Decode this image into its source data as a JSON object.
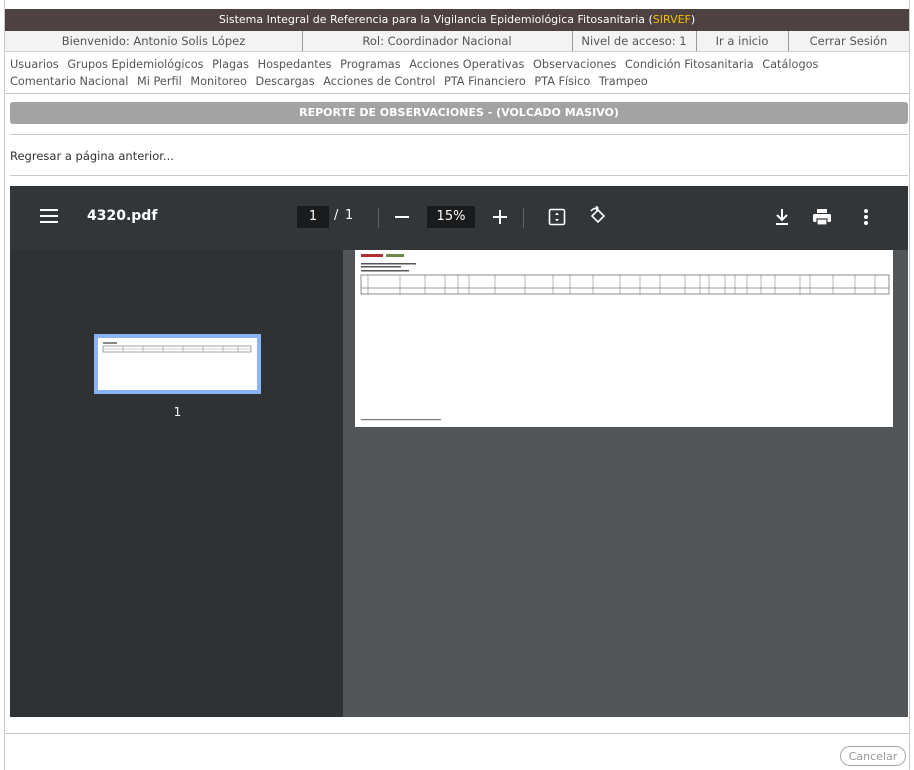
{
  "app": {
    "title_prefix": "Sistema Integral de Referencia para la Vigilancia Epidemiológica Fitosanitaria (",
    "title_highlight": "SIRVEF",
    "title_suffix": ")"
  },
  "userbar": {
    "welcome": "Bienvenido: Antonio Solis López",
    "role": "Rol: Coordinador Nacional",
    "access": "Nivel de acceso: 1",
    "home": "Ir a inicio",
    "logout": "Cerrar Sesión"
  },
  "menu": {
    "items": [
      "Usuarios",
      "Grupos Epidemiológicos",
      "Plagas",
      "Hospedantes",
      "Programas",
      "Acciones Operativas",
      "Observaciones",
      "Condición Fitosanitaria",
      "Catálogos",
      "Comentario Nacional",
      "Mi Perfil",
      "Monitoreo",
      "Descargas",
      "Acciones de Control",
      "PTA Financiero",
      "PTA Físico",
      "Trampeo"
    ]
  },
  "report": {
    "title": "REPORTE DE OBSERVACIONES - (VOLCADO MASIVO)"
  },
  "back_link": "Regresar a página anterior...",
  "pdf": {
    "filename": "4320.pdf",
    "current_page": "1",
    "page_sep": "/",
    "total_pages": "1",
    "zoom": "15%",
    "thumb_label": "1",
    "icons": [
      "menu-icon",
      "zoom-out-icon",
      "zoom-in-icon",
      "fit-page-icon",
      "rotate-icon",
      "download-icon",
      "print-icon",
      "more-icon"
    ]
  },
  "buttons": {
    "cancel": "Cancelar"
  },
  "colors": {
    "titlebar": "#4d4141",
    "highlight": "#f2c200",
    "report_bar": "#a3a3a3",
    "viewer_toolbar": "#323639",
    "viewer_bg": "#525659",
    "thumb_border": "#8ab4f8"
  }
}
